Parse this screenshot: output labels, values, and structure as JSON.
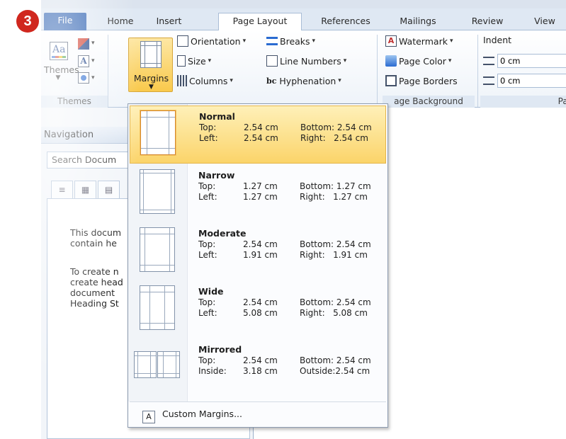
{
  "step_badge": "3",
  "tabs": [
    {
      "label": "File"
    },
    {
      "label": "Home"
    },
    {
      "label": "Insert"
    },
    {
      "label": "Page Layout"
    },
    {
      "label": "References"
    },
    {
      "label": "Mailings"
    },
    {
      "label": "Review"
    },
    {
      "label": "View"
    }
  ],
  "ribbon": {
    "themes": {
      "label": "Themes",
      "group": "Themes"
    },
    "margins": {
      "label": "Margins"
    },
    "orientation": "Orientation",
    "size": "Size",
    "columns": "Columns",
    "breaks": "Breaks",
    "line_numbers": "Line Numbers",
    "hyphenation": "Hyphenation",
    "watermark": "Watermark",
    "page_color": "Page Color",
    "page_borders": "Page Borders",
    "page_background_group": "age Background",
    "indent_label": "Indent",
    "indent_left": "0 cm",
    "indent_right": "0 cm",
    "para_group": "Para"
  },
  "navigation": {
    "title": "Navigation",
    "search_placeholder": "Search Docum",
    "body_lines_1": [
      "This docum",
      "contain he"
    ],
    "body_lines_2": [
      "To create n",
      "create head",
      "document",
      "Heading St"
    ]
  },
  "margins_menu": {
    "options": [
      {
        "name": "Normal",
        "r1": [
          "Top:",
          "2.54 cm",
          "Bottom: 2.54 cm"
        ],
        "r2": [
          "Left:",
          "2.54 cm",
          "Right:   2.54 cm"
        ],
        "selected": true
      },
      {
        "name": "Narrow",
        "r1": [
          "Top:",
          "1.27 cm",
          "Bottom: 1.27 cm"
        ],
        "r2": [
          "Left:",
          "1.27 cm",
          "Right:   1.27 cm"
        ]
      },
      {
        "name": "Moderate",
        "r1": [
          "Top:",
          "2.54 cm",
          "Bottom: 2.54 cm"
        ],
        "r2": [
          "Left:",
          "1.91 cm",
          "Right:   1.91 cm"
        ]
      },
      {
        "name": "Wide",
        "r1": [
          "Top:",
          "2.54 cm",
          "Bottom: 2.54 cm"
        ],
        "r2": [
          "Left:",
          "5.08 cm",
          "Right:   5.08 cm"
        ]
      },
      {
        "name": "Mirrored",
        "r1": [
          "Top:",
          "2.54 cm",
          "Bottom: 2.54 cm"
        ],
        "r2": [
          "Inside:",
          "3.18 cm",
          "Outside:2.54 cm"
        ]
      }
    ],
    "custom_label": "Custom Margins...",
    "custom_icon": "A"
  },
  "colors": {
    "file_tab": "#2b5fb0",
    "highlight": "#fbd46a",
    "badge": "#d0271e"
  }
}
